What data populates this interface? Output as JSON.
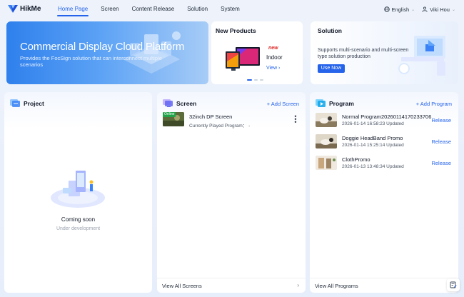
{
  "app": {
    "name": "HikMe"
  },
  "nav": {
    "items": [
      {
        "label": "Home Page",
        "active": true
      },
      {
        "label": "Screen",
        "active": false
      },
      {
        "label": "Content Release",
        "active": false
      },
      {
        "label": "Solution",
        "active": false
      },
      {
        "label": "System",
        "active": false
      }
    ]
  },
  "topright": {
    "language": "English",
    "user": "Viki Hou"
  },
  "banner": {
    "title": "Commercial Display Cloud Platform",
    "desc": "Provides the FocSign solution that can interconnect multiple scenarios"
  },
  "new_products": {
    "title": "New Products",
    "badge": "new",
    "name": "Indoor",
    "view": "View"
  },
  "solution": {
    "title": "Solution",
    "desc": "Supports multi-scenario and multi-screen type solution production",
    "button": "Use Now"
  },
  "project": {
    "title": "Project",
    "status": "Coming soon",
    "sub": "Under development"
  },
  "screen": {
    "title": "Screen",
    "add": "+ Add Screen",
    "items": [
      {
        "status": "Online",
        "name": "32inch DP Screen",
        "sub": "Currently Played Program： -"
      }
    ],
    "footer": "View All Screens"
  },
  "program": {
    "title": "Program",
    "add": "+ Add Program",
    "items": [
      {
        "name": "Normal Program20260114170233706",
        "updated": "2026-01-14 16:58:23 Updated",
        "action": "Release"
      },
      {
        "name": "Doggie HeadBand Promo",
        "updated": "2026-01-14 15:25:14 Updated",
        "action": "Release"
      },
      {
        "name": "ClothPromo",
        "updated": "2026-01-13 13:48:34 Updated",
        "action": "Release"
      }
    ],
    "footer": "View All Programs"
  },
  "colors": {
    "accent": "#2563eb",
    "online": "#22a44a",
    "badge": "#dc2626"
  }
}
